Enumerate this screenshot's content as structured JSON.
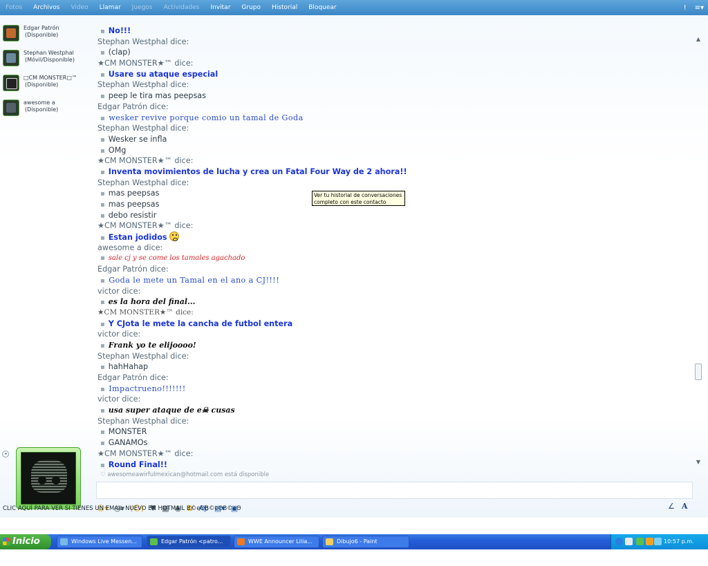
{
  "menubar": {
    "items": [
      {
        "label": "Fotos",
        "dim": true
      },
      {
        "label": "Archivos",
        "dim": false
      },
      {
        "label": "Video",
        "dim": true
      },
      {
        "label": "Llamar",
        "dim": false
      },
      {
        "label": "Juegos",
        "dim": true
      },
      {
        "label": "Actividades",
        "dim": true
      },
      {
        "label": "Invitar",
        "dim": false
      },
      {
        "label": "Grupo",
        "dim": false
      },
      {
        "label": "Historial",
        "dim": false
      },
      {
        "label": "Bloquear",
        "dim": false
      }
    ],
    "right_icons": [
      "alert-icon",
      "menu-icon"
    ]
  },
  "contacts": [
    {
      "name": "Edgar Patrón",
      "status": "(Disponible)"
    },
    {
      "name": "Stephan Westphal",
      "status": "(Móvil/Disponible)"
    },
    {
      "name": "□CM MONSTER□™",
      "status": "(Disponible)"
    },
    {
      "name": "awesome a",
      "status": "(Disponible)"
    }
  ],
  "conversation": [
    {
      "kind": "msg",
      "style": "cm",
      "text": "No!!!"
    },
    {
      "kind": "speaker",
      "text": "Stephan Westphal dice:"
    },
    {
      "kind": "msg",
      "style": "default",
      "text": "(clap)"
    },
    {
      "kind": "speaker",
      "text": "★CM MONSTER★™ dice:"
    },
    {
      "kind": "msg",
      "style": "cm",
      "text": "Usare su ataque especial"
    },
    {
      "kind": "speaker",
      "text": "Stephan Westphal dice:"
    },
    {
      "kind": "msg",
      "style": "default",
      "text": "peep le tira mas peepsas"
    },
    {
      "kind": "speaker",
      "text": "Edgar Patrón dice:"
    },
    {
      "kind": "msg",
      "style": "edgar",
      "text": "wesker revive porque comio un tamal de Goda"
    },
    {
      "kind": "speaker",
      "text": "Stephan Westphal dice:"
    },
    {
      "kind": "msg",
      "style": "default",
      "text": "Wesker se infla"
    },
    {
      "kind": "msg",
      "style": "default",
      "text": "OMg"
    },
    {
      "kind": "speaker",
      "text": "★CM MONSTER★™ dice:"
    },
    {
      "kind": "msg",
      "style": "cm",
      "text": "Inventa movimientos de lucha y crea un Fatal Four Way de 2 ahora!!"
    },
    {
      "kind": "speaker",
      "text": "Stephan Westphal dice:"
    },
    {
      "kind": "msg",
      "style": "default",
      "text": "mas peepsas"
    },
    {
      "kind": "msg",
      "style": "default",
      "text": "mas peepsas"
    },
    {
      "kind": "msg",
      "style": "default",
      "text": "debo resistir"
    },
    {
      "kind": "speaker",
      "text": "★CM MONSTER★™ dice:"
    },
    {
      "kind": "msg",
      "style": "cm",
      "text": "Estan jodidos",
      "emoticon": true
    },
    {
      "kind": "speaker",
      "text": "awesome a dice:"
    },
    {
      "kind": "msg",
      "style": "awesome",
      "text": "sale cj y se come los tamales agachado"
    },
    {
      "kind": "speaker",
      "text": "Edgar Patrón dice:"
    },
    {
      "kind": "msg",
      "style": "edgar",
      "text": "Goda le mete un Tamal en el ano a CJ!!!!"
    },
    {
      "kind": "speaker",
      "text": "victor dice:"
    },
    {
      "kind": "msg",
      "style": "victor",
      "text": "es la hora del final..."
    },
    {
      "kind": "speaker",
      "style": "serif",
      "text": "★CM MONSTER★™ dice:"
    },
    {
      "kind": "msg",
      "style": "cm",
      "text": "Y CJota le mete la cancha de futbol entera"
    },
    {
      "kind": "speaker",
      "text": "victor dice:"
    },
    {
      "kind": "msg",
      "style": "victor",
      "text": "Frank yo te elijoooo!"
    },
    {
      "kind": "speaker",
      "text": "Stephan Westphal dice:"
    },
    {
      "kind": "msg",
      "style": "default",
      "text": "hahHahap"
    },
    {
      "kind": "speaker",
      "text": "Edgar Patrón dice:"
    },
    {
      "kind": "msg",
      "style": "edgar",
      "text": "Impactrueno!!!!!!!"
    },
    {
      "kind": "speaker",
      "text": "victor dice:"
    },
    {
      "kind": "msg",
      "style": "victor",
      "text": "usa super ataque de e☠ cusas"
    },
    {
      "kind": "speaker",
      "text": "Stephan Westphal dice:"
    },
    {
      "kind": "msg",
      "style": "default",
      "text": "MONSTER"
    },
    {
      "kind": "msg",
      "style": "default",
      "text": "GANAMOs"
    },
    {
      "kind": "speaker",
      "text": "★CM MONSTER★™ dice:"
    },
    {
      "kind": "msg",
      "style": "cm",
      "text": "Round Final!!"
    },
    {
      "kind": "status",
      "text": "awesomeawirfulmexican@hotmail.com está disponible"
    }
  ],
  "tooltip": {
    "line1": "Ver tu historial de conversaciones",
    "line2": "completo con este contacto"
  },
  "toolbar": {
    "icons": [
      "emoticon-icon",
      "wink-icon",
      "nudge-icon",
      "voice-clip-icon",
      "background-icon",
      "games-icon",
      "activities-icon",
      "font-icon",
      "send-file-icon",
      "format-icon"
    ]
  },
  "hotmail_banner": "CLIC AQUÍ PARA VER SI TIENES UN EMAIL NUEVO EN HOTMAIL B©еΘB©еΘB©еΘ",
  "taskbar": {
    "start_label": "Inicio",
    "buttons": [
      {
        "label": "Windows Live Messen...",
        "active": false
      },
      {
        "label": "Edgar Patrón <patro...",
        "active": true
      },
      {
        "label": "WWE Announcer Lilia...",
        "active": false
      },
      {
        "label": "Dibujo6 - Paint",
        "active": false
      }
    ],
    "clock": "10:57 p.m."
  }
}
